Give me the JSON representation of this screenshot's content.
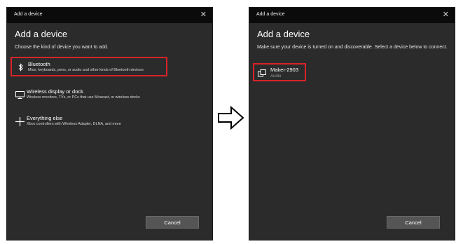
{
  "dialog_left": {
    "title": "Add a device",
    "close_glyph": "✕",
    "heading": "Add a device",
    "subtext": "Choose the kind of device you want to add.",
    "options": [
      {
        "label": "Bluetooth",
        "desc": "Mice, keyboards, pens, or audio and other kinds of Bluetooth devices",
        "icon": "bluetooth-icon",
        "highlighted": true
      },
      {
        "label": "Wireless display or dock",
        "desc": "Wireless monitors, TVs, or PCs that use Miracast, or wireless docks",
        "icon": "monitor-icon",
        "highlighted": false
      },
      {
        "label": "Everything else",
        "desc": "Xbox controllers with Wireless Adapter, DLNA, and more",
        "icon": "plus-icon",
        "highlighted": false
      }
    ],
    "cancel_label": "Cancel"
  },
  "dialog_right": {
    "title": "Add a device",
    "close_glyph": "✕",
    "heading": "Add a device",
    "subtext": "Make sure your device is turned on and discoverable. Select a device below to connect.",
    "device": {
      "name": "Maker-2903",
      "type": "Audio",
      "icon": "audio-device-icon"
    },
    "cancel_label": "Cancel"
  },
  "transition_arrow": {
    "icon": "right-arrow-icon"
  },
  "colors": {
    "dialog_bg": "#2b2b2b",
    "titlebar_bg": "#0b0b0b",
    "highlight_red": "#d8232a",
    "button_bg": "#555555"
  }
}
